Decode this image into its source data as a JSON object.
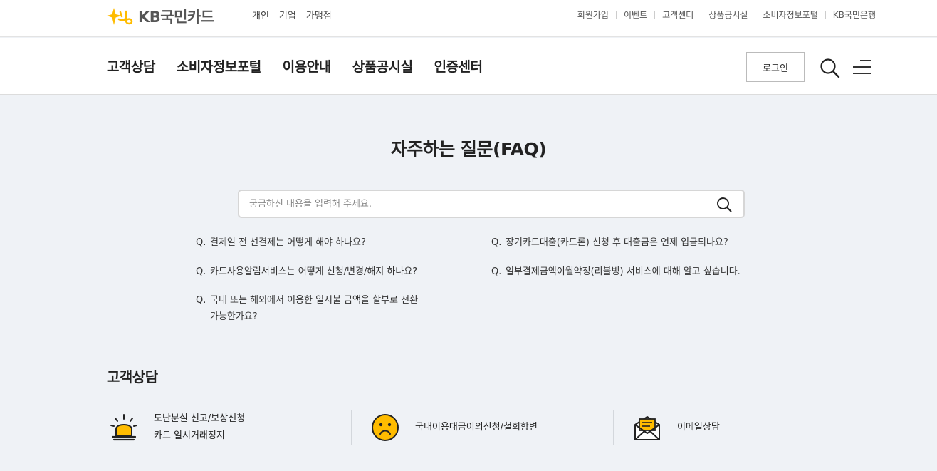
{
  "colors": {
    "brand_yellow": "#ffbc00",
    "text": "#222222",
    "bg": "#eff2f6"
  },
  "header": {
    "logo_text": "KB국민카드",
    "segments": [
      "개인",
      "기업",
      "가맹점"
    ],
    "util_links": [
      "회원가입",
      "이벤트",
      "고객센터",
      "상품공시실",
      "소비자정보포털",
      "KB국민은행"
    ]
  },
  "gnb": {
    "menu": [
      "고객상담",
      "소비자정보포털",
      "이용안내",
      "상품공시실",
      "인증센터"
    ],
    "login_label": "로그인",
    "icons": [
      "search-icon",
      "hamburger-icon"
    ]
  },
  "faq": {
    "title": "자주하는 질문(FAQ)",
    "search_placeholder": "궁금하신 내용을 입력해 주세요.",
    "q_prefix": "Q.",
    "items": [
      "결제일 전 선결제는 어떻게 해야 하나요?",
      "장기카드대출(카드론) 신청 후 대출금은 언제 입금되나요?",
      "카드사용알림서비스는 어떻게 신청/변경/해지 하나요?",
      "일부결제금액이월약정(리볼빙) 서비스에 대해 알고 싶습니다.",
      "국내 또는 해외에서 이용한 일시불 금액을 할부로 전환",
      "가능한가요?"
    ]
  },
  "consult": {
    "title": "고객상담",
    "items": [
      {
        "icon": "siren-icon",
        "lines": [
          "도난분실 신고/보상신청",
          "카드 일시거래정지"
        ]
      },
      {
        "icon": "sad-face-icon",
        "lines": [
          "국내이용대금이의신청/철회항변"
        ]
      },
      {
        "icon": "envelope-icon",
        "lines": [
          "이메일상담"
        ]
      }
    ]
  }
}
